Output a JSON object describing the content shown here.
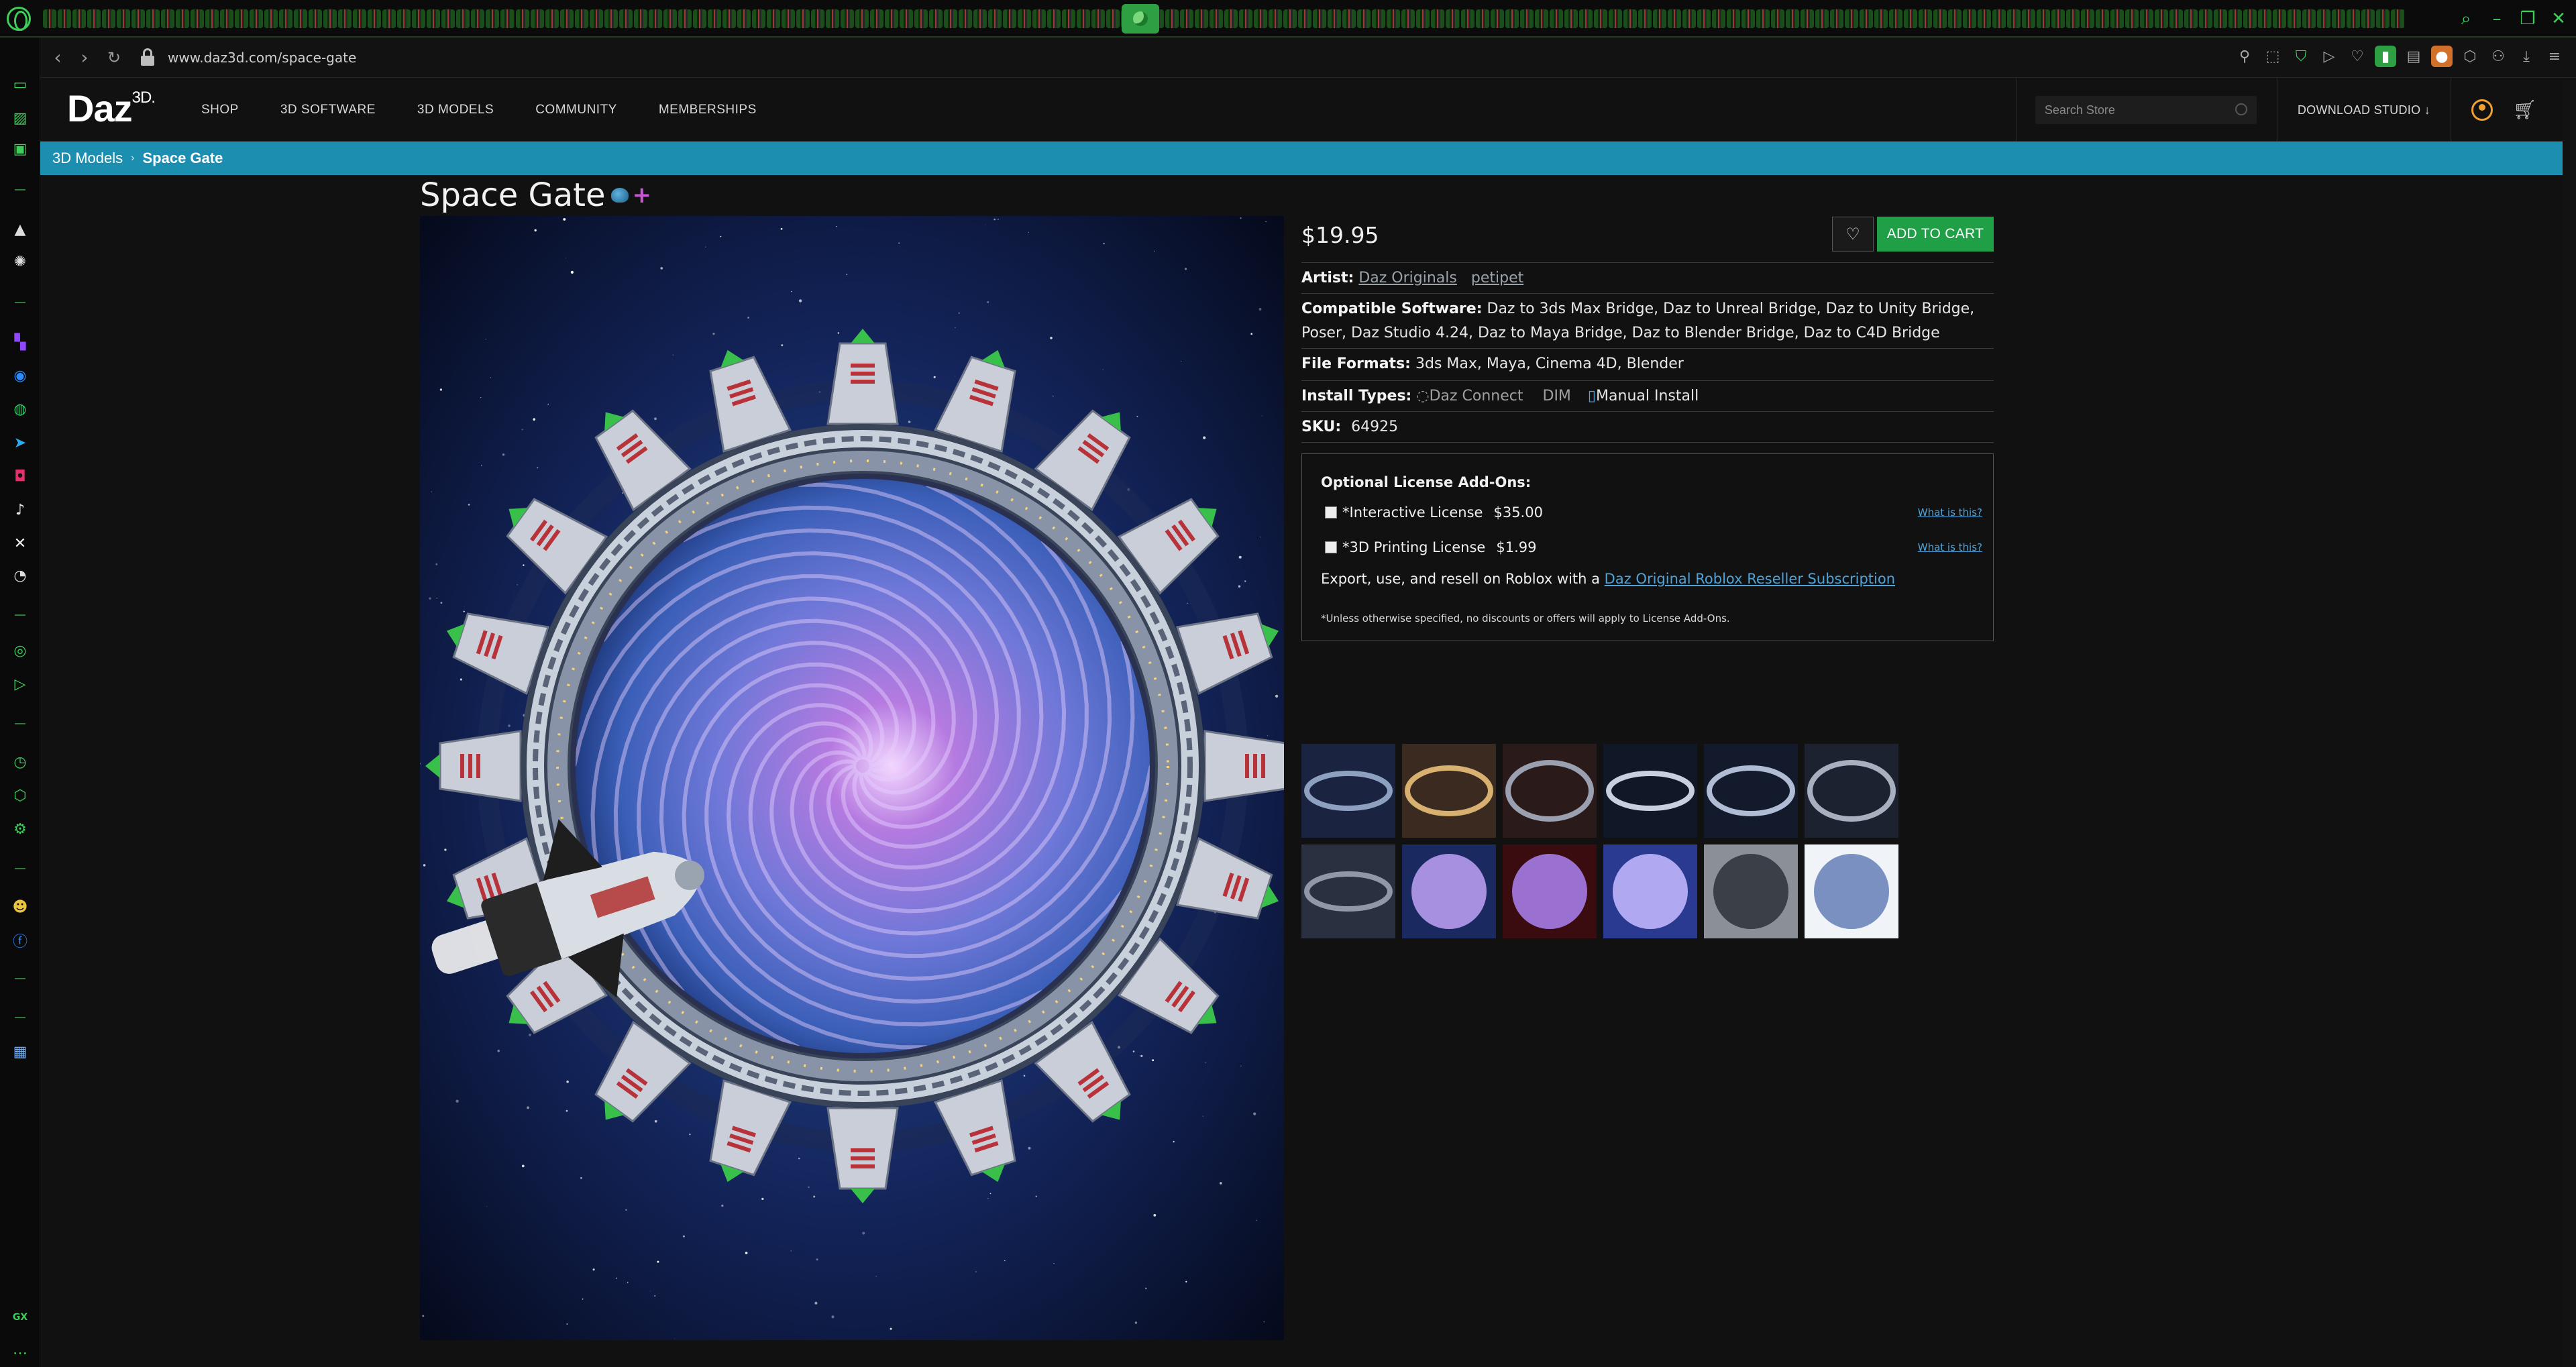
{
  "browser": {
    "url": "www.daz3d.com/space-gate"
  },
  "site": {
    "logo_text": "Daz",
    "logo_sup": "3D.",
    "nav": [
      "SHOP",
      "3D SOFTWARE",
      "3D MODELS",
      "COMMUNITY",
      "MEMBERSHIPS"
    ],
    "search_placeholder": "Search Store",
    "download_label": "DOWNLOAD STUDIO",
    "download_arrow": "↓"
  },
  "breadcrumb": {
    "parent": "3D Models",
    "separator": "›",
    "current": "Space Gate"
  },
  "product": {
    "title": "Space Gate",
    "plus_badge": "+",
    "price": "$19.95",
    "add_to_cart": "ADD TO CART",
    "wishlist_icon": "♡",
    "artist_label": "Artist:",
    "artists": [
      "Daz Originals",
      "petipet"
    ],
    "software_label": "Compatible Software:",
    "software": "Daz to 3ds Max Bridge, Daz to Unreal Bridge, Daz to Unity Bridge, Poser, Daz Studio 4.24, Daz to Maya Bridge, Daz to Blender Bridge, Daz to C4D Bridge",
    "formats_label": "File Formats:",
    "formats": "3ds Max, Maya, Cinema 4D, Blender",
    "install_label": "Install Types:",
    "install_types": [
      "Daz Connect",
      "DIM",
      "Manual Install"
    ],
    "sku_label": "SKU:",
    "sku": "64925"
  },
  "license": {
    "title": "Optional License Add-Ons:",
    "items": [
      {
        "name": "*Interactive License",
        "price": "$35.00",
        "help": "What is this?"
      },
      {
        "name": "*3D Printing License",
        "price": "$1.99",
        "help": "What is this?"
      }
    ],
    "roblox_prefix": "Export, use, and resell on Roblox with a ",
    "roblox_link": "Daz Original Roblox Reseller Subscription",
    "note": "*Unless otherwise specified, no discounts or offers will apply to License Add-Ons."
  },
  "thumbnails_count": 12,
  "colors": {
    "accent_bar": "#1c8fb0",
    "cart_button": "#1fa046",
    "link": "#4fa3d9",
    "gx_green": "#3ecf5a"
  },
  "icons": {
    "sidebar": [
      "news-icon",
      "translate-icon",
      "messages-icon",
      "aria-icon",
      "settings-icon",
      "twitch-icon",
      "messenger-icon",
      "whatsapp-icon",
      "telegram-icon",
      "instagram-icon",
      "tiktok-icon",
      "x-icon",
      "discord-icon",
      "player-icon",
      "send-icon",
      "history-icon",
      "extensions-icon",
      "settings-gear-icon",
      "mascot-icon",
      "facebook-icon",
      "calendar-icon"
    ]
  }
}
